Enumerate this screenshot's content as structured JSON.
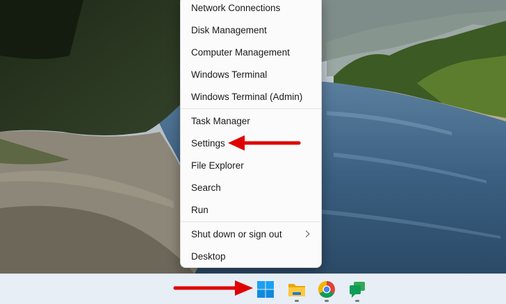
{
  "context_menu": {
    "items": [
      {
        "label": "Network Connections"
      },
      {
        "label": "Disk Management"
      },
      {
        "label": "Computer Management"
      },
      {
        "label": "Windows Terminal"
      },
      {
        "label": "Windows Terminal (Admin)"
      },
      {
        "label": "Task Manager"
      },
      {
        "label": "Settings"
      },
      {
        "label": "File Explorer"
      },
      {
        "label": "Search"
      },
      {
        "label": "Run"
      },
      {
        "label": "Shut down or sign out",
        "has_submenu": true
      },
      {
        "label": "Desktop"
      }
    ]
  },
  "taskbar": {
    "icons": [
      "windows-start-icon",
      "file-explorer-icon",
      "chrome-icon",
      "chat-icon"
    ]
  },
  "colors": {
    "annotation_arrow": "#e00000",
    "taskbar_bg": "#e8eef5",
    "menu_bg": "#fbfbfb"
  }
}
